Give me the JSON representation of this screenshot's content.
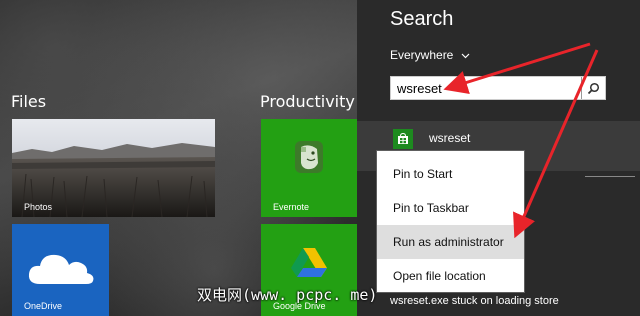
{
  "start_screen": {
    "groups": [
      {
        "label": "Files"
      },
      {
        "label": "Productivity"
      }
    ],
    "tiles": {
      "photos": {
        "label": "Photos",
        "icon": "landscape-photo"
      },
      "evernote": {
        "label": "Evernote",
        "icon": "evernote-elephant-icon",
        "color": "#23a013"
      },
      "onedrive": {
        "label": "OneDrive",
        "icon": "cloud-icon",
        "color": "#1a64c0"
      },
      "google_drive": {
        "label": "Google Drive",
        "icon": "google-drive-icon",
        "color": "#23a013"
      }
    }
  },
  "search_charm": {
    "title": "Search",
    "scope": "Everywhere",
    "query": "wsreset",
    "search_button_icon": "search-icon",
    "result": {
      "label": "wsreset",
      "icon": "store-icon"
    },
    "footer_result": "wsreset.exe stuck on loading store"
  },
  "context_menu": {
    "items": [
      {
        "label": "Pin to Start"
      },
      {
        "label": "Pin to Taskbar"
      },
      {
        "label": "Run as administrator",
        "highlighted": true
      },
      {
        "label": "Open file location"
      }
    ]
  },
  "annotation": {
    "arrow_color": "#e8242a"
  },
  "watermark": "双电网(www. pcpc. me)"
}
